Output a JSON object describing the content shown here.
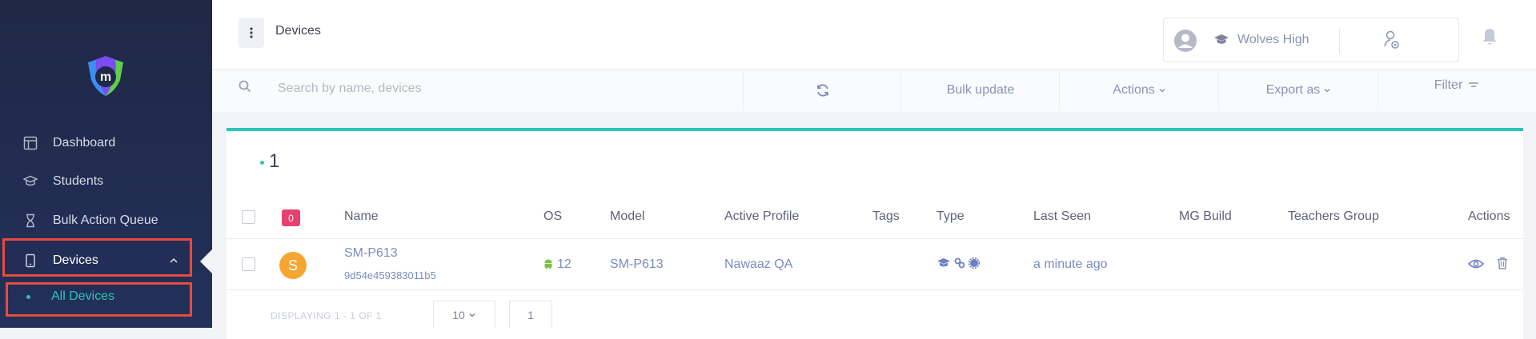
{
  "sidebar": {
    "items": [
      {
        "label": "Dashboard",
        "icon": "dashboard-icon"
      },
      {
        "label": "Students",
        "icon": "graduation-cap-icon"
      },
      {
        "label": "Bulk Action Queue",
        "icon": "hourglass-icon"
      },
      {
        "label": "Devices",
        "icon": "tablet-icon"
      }
    ],
    "sub_items": [
      {
        "label": "All Devices"
      }
    ]
  },
  "header": {
    "title": "Devices",
    "school": "Wolves High"
  },
  "toolbar": {
    "search_placeholder": "Search by name, devices",
    "bulk_update": "Bulk update",
    "actions": "Actions",
    "export": "Export as",
    "filter": "Filter"
  },
  "summary": {
    "count": "1"
  },
  "table": {
    "selected_count": "0",
    "headers": [
      "Name",
      "OS",
      "Model",
      "Active Profile",
      "Tags",
      "Type",
      "Last Seen",
      "MG Build",
      "Teachers Group",
      "Actions"
    ],
    "rows": [
      {
        "avatar": "S",
        "name": "SM-P613",
        "serial": "9d54e459383011b5",
        "os": "12",
        "model": "SM-P613",
        "profile": "Nawaaz QA",
        "tags": "",
        "last_seen": "a minute ago",
        "mg_build": "",
        "teachers_group": ""
      }
    ]
  },
  "footer": {
    "display_text": "DISPLAYING 1 - 1 OF 1",
    "page_size": "10",
    "page": "1"
  },
  "colors": {
    "accent": "#2ec4b6",
    "sidebar_bg": "#1f2846",
    "badge": "#e8416e",
    "highlight": "#e84b3c",
    "link": "#7a8bc2"
  }
}
